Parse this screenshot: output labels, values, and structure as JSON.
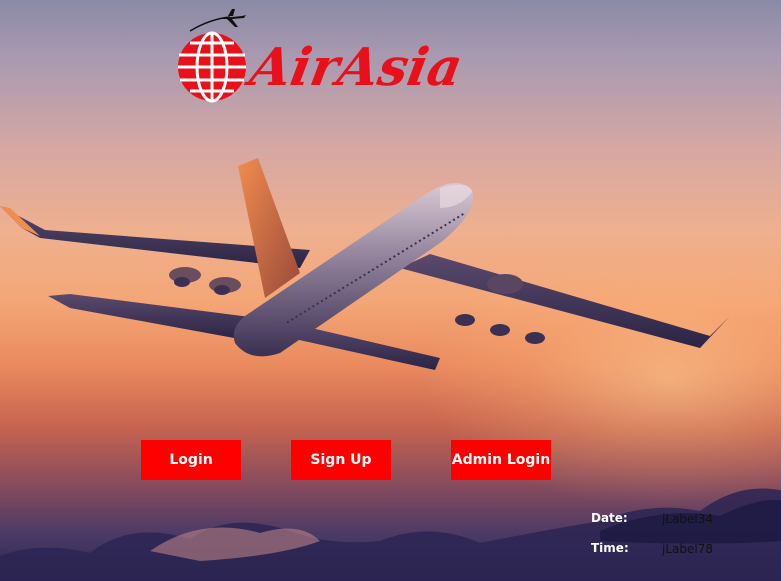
{
  "app": {
    "brand": "AirAsia",
    "brand_color": "#e8111b"
  },
  "buttons": {
    "login_label": "Login",
    "signup_label": "Sign Up",
    "admin_login_label": "Admin Login",
    "color": "#ff0000"
  },
  "info": {
    "date_label": "Date:",
    "date_value": "jLabel34",
    "time_label": "Time:",
    "time_value": "jLabel78"
  },
  "icons": {
    "logo": "globe-airplane-logo",
    "background": "airplane-sunset-photo"
  }
}
